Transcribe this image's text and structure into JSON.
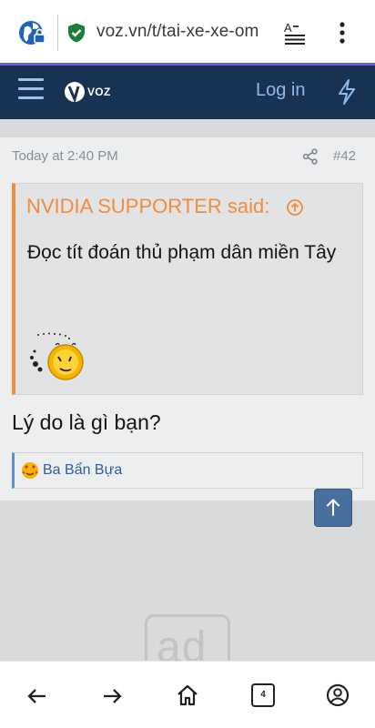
{
  "browser": {
    "url": "voz.vn/t/tai-xe-xe-om",
    "tab_count": "4",
    "icons": [
      "site-settings-icon",
      "lock-icon",
      "reader-mode-icon",
      "menu-icon",
      "back-icon",
      "forward-icon",
      "home-icon",
      "tabs-icon",
      "account-icon"
    ]
  },
  "header": {
    "logo": "VOZ",
    "login_label": "Log in",
    "colors": {
      "bar": "#183254",
      "accent": "#8fbbe8"
    }
  },
  "post": {
    "timestamp": "Today at 2:40 PM",
    "number": "#42",
    "quote": {
      "author_label": "NVIDIA SUPPORTER said:",
      "text": "Đọc tít đoán thủ phạm dân miền Tây",
      "accent": "#f28b3c"
    },
    "body": "Lý do là gì bạn?",
    "reaction": {
      "user": "Ba Bẩn Bựa"
    }
  },
  "ad": {
    "label": "ad"
  }
}
